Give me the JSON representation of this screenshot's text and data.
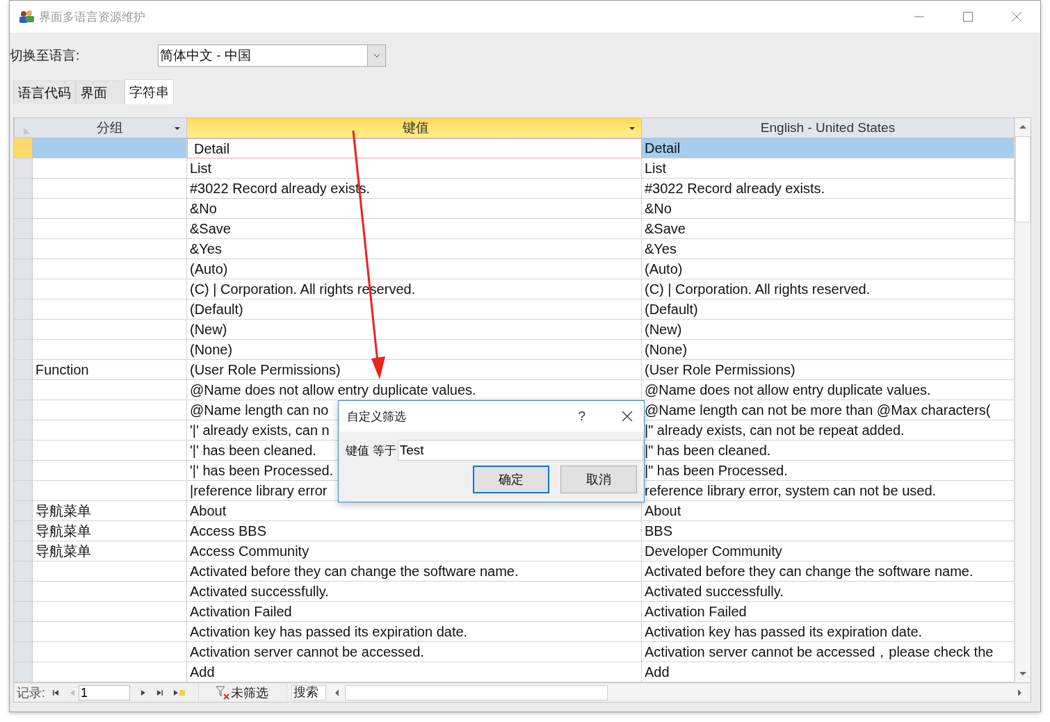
{
  "window": {
    "title": "界面多语言资源维护"
  },
  "language": {
    "label": "切换至语言:",
    "value": "简体中文 - 中国"
  },
  "tabs": [
    {
      "label": "语言代码",
      "selected": false
    },
    {
      "label": "界面",
      "selected": false
    },
    {
      "label": "字符串",
      "selected": true
    }
  ],
  "table": {
    "columns": [
      {
        "label": "分组",
        "dropdown": true,
        "selected": false
      },
      {
        "label": "键值",
        "dropdown": true,
        "selected": true
      },
      {
        "label": "English - United States",
        "dropdown": false,
        "selected": false
      }
    ],
    "rows": [
      {
        "key": "Detail",
        "english": "Detail",
        "selected": true
      },
      {
        "key": "List",
        "english": "List",
        "selected": false
      },
      {
        "key": "#3022 Record already exists.",
        "english": "#3022 Record already exists.",
        "selected": false
      },
      {
        "key": "&No",
        "english": "&No",
        "selected": false
      },
      {
        "key": "&Save",
        "english": "&Save",
        "selected": false
      },
      {
        "key": "&Yes",
        "english": "&Yes",
        "selected": false
      },
      {
        "key": "(Auto)",
        "english": "(Auto)",
        "selected": false
      },
      {
        "key": "(C) | Corporation. All rights reserved.",
        "english": "(C) | Corporation. All rights reserved.",
        "selected": false
      },
      {
        "key": "(Default)",
        "english": "(Default)",
        "selected": false
      },
      {
        "key": "(New)",
        "english": "(New)",
        "selected": false
      },
      {
        "key": "(None)",
        "english": "(None)",
        "selected": false
      },
      {
        "group": "Function",
        "key": "(User Role Permissions)",
        "english": "(User Role Permissions)",
        "selected": false
      },
      {
        "key": "@Name does not allow entry duplicate values.",
        "english": "@Name does not allow entry duplicate values.",
        "selected": false
      },
      {
        "key": "@Name length can no",
        "english": "@Name length can not be more than @Max characters(",
        "selected": false
      },
      {
        "key": "'|' already exists, can n",
        "english": "|\" already exists, can not be repeat added.",
        "selected": false
      },
      {
        "key": "'|' has been cleaned.",
        "english": "|\" has been cleaned.",
        "selected": false
      },
      {
        "key": "'|' has been Processed.",
        "english": "|\" has been Processed.",
        "selected": false
      },
      {
        "key": "|reference library error",
        "english": "reference library error, system can not be used.",
        "selected": false
      },
      {
        "group": "导航菜单",
        "key": "About",
        "english": "About",
        "selected": false
      },
      {
        "group": "导航菜单",
        "key": "Access BBS",
        "english": "BBS",
        "selected": false
      },
      {
        "group": "导航菜单",
        "key": "Access Community",
        "english": "Developer Community",
        "selected": false
      },
      {
        "key": "Activated before they can change the software name.",
        "english": "Activated before they can change the software name.",
        "selected": false
      },
      {
        "key": "Activated successfully.",
        "english": "Activated successfully.",
        "selected": false
      },
      {
        "key": "Activation Failed",
        "english": "Activation Failed",
        "selected": false
      },
      {
        "key": "Activation key has passed its expiration date.",
        "english": "Activation key has passed its expiration date.",
        "selected": false
      },
      {
        "key": "Activation server cannot be accessed.",
        "english": "Activation server cannot be accessed，please check the",
        "selected": false
      },
      {
        "key": "Add",
        "english": "Add",
        "selected": false
      }
    ]
  },
  "navigator": {
    "label": "记录:",
    "record": "1",
    "filter": "未筛选",
    "search": {
      "placeholder": "搜索"
    }
  },
  "dialog": {
    "title": "自定义筛选",
    "help": "?",
    "label": "键值 等于",
    "value": "Test",
    "buttons": [
      {
        "label": "确定",
        "default": true
      },
      {
        "label": "取消",
        "default": false
      }
    ]
  }
}
